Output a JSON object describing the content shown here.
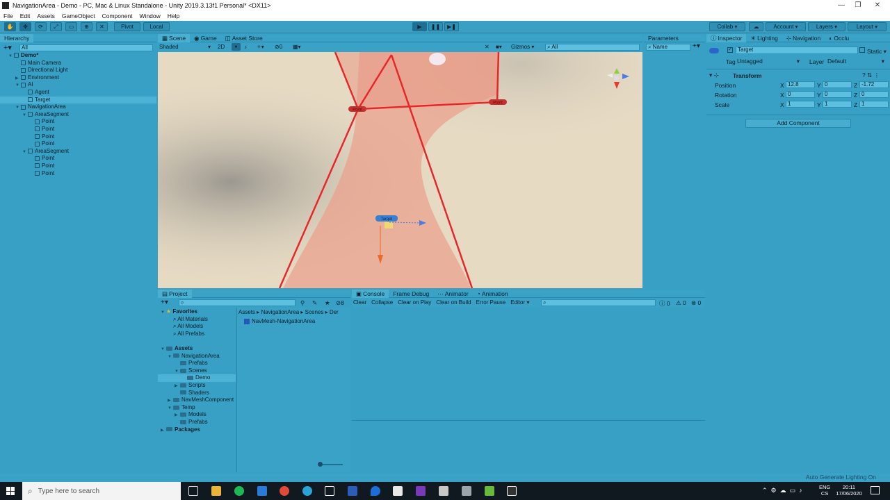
{
  "window": {
    "title": "NavigationArea - Demo - PC, Mac & Linux Standalone - Unity 2019.3.13f1 Personal* <DX11>",
    "minimize": "—",
    "maximize": "❐",
    "close": "✕"
  },
  "menu": [
    "File",
    "Edit",
    "Assets",
    "GameObject",
    "Component",
    "Window",
    "Help"
  ],
  "toolbar": {
    "pivot": "Pivot",
    "local": "Local",
    "collab": "Collab",
    "account": "Account",
    "layers": "Layers",
    "layout": "Layout"
  },
  "hierarchy": {
    "tab": "Hierarchy",
    "search_placeholder": "All",
    "items": [
      {
        "label": "Demo*",
        "depth": 0,
        "kind": "scene",
        "expanded": true,
        "bold": true
      },
      {
        "label": "Main Camera",
        "depth": 1,
        "kind": "object"
      },
      {
        "label": "Directional Light",
        "depth": 1,
        "kind": "object"
      },
      {
        "label": "Environment",
        "depth": 1,
        "kind": "object",
        "expandable": true
      },
      {
        "label": "AI",
        "depth": 1,
        "kind": "object",
        "expanded": true
      },
      {
        "label": "Agent",
        "depth": 2,
        "kind": "object"
      },
      {
        "label": "Target",
        "depth": 2,
        "kind": "object",
        "selected": true
      },
      {
        "label": "NavigationArea",
        "depth": 1,
        "kind": "object",
        "expanded": true
      },
      {
        "label": "AreaSegment",
        "depth": 2,
        "kind": "object",
        "expanded": true
      },
      {
        "label": "Point",
        "depth": 3,
        "kind": "object"
      },
      {
        "label": "Point",
        "depth": 3,
        "kind": "object"
      },
      {
        "label": "Point",
        "depth": 3,
        "kind": "object"
      },
      {
        "label": "Point",
        "depth": 3,
        "kind": "object"
      },
      {
        "label": "AreaSegment",
        "depth": 2,
        "kind": "object",
        "expanded": true
      },
      {
        "label": "Point",
        "depth": 3,
        "kind": "object"
      },
      {
        "label": "Point",
        "depth": 3,
        "kind": "object"
      },
      {
        "label": "Point",
        "depth": 3,
        "kind": "object"
      }
    ]
  },
  "scene": {
    "tabs": [
      "Scene",
      "Game",
      "Asset Store"
    ],
    "shading": "Shaded",
    "mode2d": "2D",
    "hidden_count": "0",
    "gizmos": "Gizmos",
    "search_placeholder": "All",
    "labels": {
      "point": "Point",
      "target": "Target"
    }
  },
  "parameters": {
    "tab": "Parameters",
    "search_placeholder": "Name"
  },
  "inspector": {
    "tabs": [
      "Inspector",
      "Lighting",
      "Navigation",
      "Occlu"
    ],
    "object_name": "Target",
    "static": "Static",
    "tag_label": "Tag",
    "tag_value": "Untagged",
    "layer_label": "Layer",
    "layer_value": "Default",
    "component": "Transform",
    "rows": [
      {
        "label": "Position",
        "x": "12.8",
        "y": "0",
        "z": "-1.72"
      },
      {
        "label": "Rotation",
        "x": "0",
        "y": "0",
        "z": "0"
      },
      {
        "label": "Scale",
        "x": "1",
        "y": "1",
        "z": "1"
      }
    ],
    "add_component": "Add Component"
  },
  "project": {
    "tab": "Project",
    "hidden_count": "8",
    "favorites": {
      "title": "Favorites",
      "items": [
        "All Materials",
        "All Models",
        "All Prefabs"
      ]
    },
    "assets": {
      "title": "Assets",
      "items": [
        {
          "label": "NavigationArea",
          "depth": 1,
          "expanded": true
        },
        {
          "label": "Prefabs",
          "depth": 2
        },
        {
          "label": "Scenes",
          "depth": 2,
          "expanded": true
        },
        {
          "label": "Demo",
          "depth": 3,
          "selected": true
        },
        {
          "label": "Scripts",
          "depth": 2,
          "expandable": true
        },
        {
          "label": "Shaders",
          "depth": 2
        },
        {
          "label": "NavMeshComponent",
          "depth": 1,
          "expandable": true
        },
        {
          "label": "Temp",
          "depth": 1,
          "expanded": true
        },
        {
          "label": "Models",
          "depth": 2,
          "expandable": true
        },
        {
          "label": "Prefabs",
          "depth": 2
        }
      ]
    },
    "packages": "Packages",
    "breadcrumb": [
      "Assets",
      "NavigationArea",
      "Scenes",
      "Der"
    ],
    "files": [
      "NavMesh-NavigationArea"
    ]
  },
  "console": {
    "tabs": [
      "Console",
      "Frame Debug",
      "Animator",
      "Animation"
    ],
    "buttons": [
      "Clear",
      "Collapse",
      "Clear on Play",
      "Clear on Build",
      "Error Pause",
      "Editor"
    ],
    "counts": {
      "info": "0",
      "warn": "0",
      "error": "0"
    }
  },
  "status": {
    "right_text": "Auto Generate Lighting On"
  },
  "taskbar": {
    "search_placeholder": "Type here to search",
    "lang1": "ENG",
    "lang2": "CS",
    "time": "20:11",
    "date": "17/06/2020"
  },
  "colors": {
    "accent": "#38a0c4",
    "navmesh": "#e8483c"
  }
}
